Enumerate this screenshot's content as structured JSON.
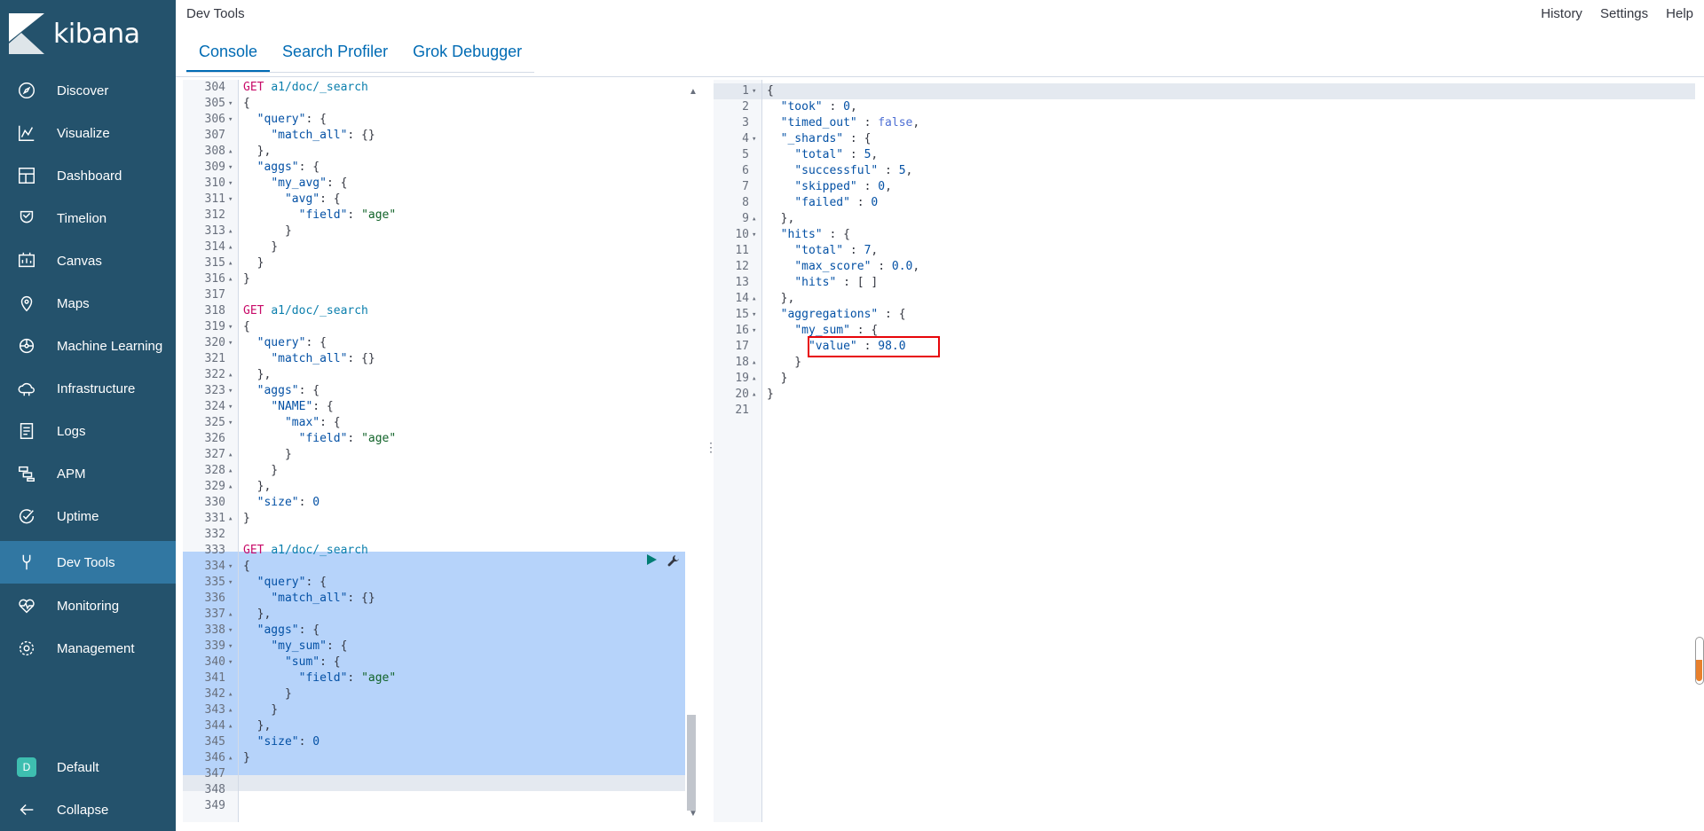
{
  "app": {
    "name": "kibana"
  },
  "sidebar": {
    "items": [
      {
        "label": "Discover",
        "icon": "compass-icon"
      },
      {
        "label": "Visualize",
        "icon": "visualize-icon"
      },
      {
        "label": "Dashboard",
        "icon": "dashboard-icon"
      },
      {
        "label": "Timelion",
        "icon": "timelion-icon"
      },
      {
        "label": "Canvas",
        "icon": "canvas-icon"
      },
      {
        "label": "Maps",
        "icon": "maps-icon"
      },
      {
        "label": "Machine Learning",
        "icon": "machine-learning-icon"
      },
      {
        "label": "Infrastructure",
        "icon": "infrastructure-icon"
      },
      {
        "label": "Logs",
        "icon": "logs-icon"
      },
      {
        "label": "APM",
        "icon": "apm-icon"
      },
      {
        "label": "Uptime",
        "icon": "uptime-icon"
      },
      {
        "label": "Dev Tools",
        "icon": "devtools-icon",
        "active": true
      },
      {
        "label": "Monitoring",
        "icon": "monitoring-icon"
      },
      {
        "label": "Management",
        "icon": "gear-icon"
      }
    ],
    "space": {
      "badge": "D",
      "label": "Default"
    },
    "collapse": {
      "label": "Collapse"
    }
  },
  "header": {
    "breadcrumb": "Dev Tools",
    "links": [
      "History",
      "Settings",
      "Help"
    ],
    "tabs": [
      {
        "label": "Console",
        "active": true
      },
      {
        "label": "Search Profiler"
      },
      {
        "label": "Grok Debugger"
      }
    ]
  },
  "colors": {
    "sidebar": "#24526c",
    "active": "#3177a2",
    "accent": "#006bb4",
    "highlight": "#e7050a",
    "selection": "#b6d3fa"
  },
  "editor": {
    "lines": [
      {
        "n": "304",
        "f": "",
        "code": "GET a1/doc/_search"
      },
      {
        "n": "305",
        "f": "▾",
        "code": "{"
      },
      {
        "n": "306",
        "f": "▾",
        "code": "  \"query\": {"
      },
      {
        "n": "307",
        "f": "",
        "code": "    \"match_all\": {}"
      },
      {
        "n": "308",
        "f": "▴",
        "code": "  },"
      },
      {
        "n": "309",
        "f": "▾",
        "code": "  \"aggs\": {"
      },
      {
        "n": "310",
        "f": "▾",
        "code": "    \"my_avg\": {"
      },
      {
        "n": "311",
        "f": "▾",
        "code": "      \"avg\": {"
      },
      {
        "n": "312",
        "f": "",
        "code": "        \"field\": \"age\""
      },
      {
        "n": "313",
        "f": "▴",
        "code": "      }"
      },
      {
        "n": "314",
        "f": "▴",
        "code": "    }"
      },
      {
        "n": "315",
        "f": "▴",
        "code": "  }"
      },
      {
        "n": "316",
        "f": "▴",
        "code": "}"
      },
      {
        "n": "317",
        "f": "",
        "code": ""
      },
      {
        "n": "318",
        "f": "",
        "code": "GET a1/doc/_search"
      },
      {
        "n": "319",
        "f": "▾",
        "code": "{"
      },
      {
        "n": "320",
        "f": "▾",
        "code": "  \"query\": {"
      },
      {
        "n": "321",
        "f": "",
        "code": "    \"match_all\": {}"
      },
      {
        "n": "322",
        "f": "▴",
        "code": "  },"
      },
      {
        "n": "323",
        "f": "▾",
        "code": "  \"aggs\": {"
      },
      {
        "n": "324",
        "f": "▾",
        "code": "    \"NAME\": {"
      },
      {
        "n": "325",
        "f": "▾",
        "code": "      \"max\": {"
      },
      {
        "n": "326",
        "f": "",
        "code": "        \"field\": \"age\""
      },
      {
        "n": "327",
        "f": "▴",
        "code": "      }"
      },
      {
        "n": "328",
        "f": "▴",
        "code": "    }"
      },
      {
        "n": "329",
        "f": "▴",
        "code": "  },"
      },
      {
        "n": "330",
        "f": "",
        "code": "  \"size\": 0"
      },
      {
        "n": "331",
        "f": "▴",
        "code": "}"
      },
      {
        "n": "332",
        "f": "",
        "code": ""
      },
      {
        "n": "333",
        "f": "",
        "code": "GET a1/doc/_search"
      },
      {
        "n": "334",
        "f": "▾",
        "code": "{"
      },
      {
        "n": "335",
        "f": "▾",
        "code": "  \"query\": {"
      },
      {
        "n": "336",
        "f": "",
        "code": "    \"match_all\": {}"
      },
      {
        "n": "337",
        "f": "▴",
        "code": "  },"
      },
      {
        "n": "338",
        "f": "▾",
        "code": "  \"aggs\": {"
      },
      {
        "n": "339",
        "f": "▾",
        "code": "    \"my_sum\": {"
      },
      {
        "n": "340",
        "f": "▾",
        "code": "      \"sum\": {"
      },
      {
        "n": "341",
        "f": "",
        "code": "        \"field\": \"age\""
      },
      {
        "n": "342",
        "f": "▴",
        "code": "      }"
      },
      {
        "n": "343",
        "f": "▴",
        "code": "    }"
      },
      {
        "n": "344",
        "f": "▴",
        "code": "  },"
      },
      {
        "n": "345",
        "f": "",
        "code": "  \"size\": 0"
      },
      {
        "n": "346",
        "f": "▴",
        "code": "}"
      },
      {
        "n": "347",
        "f": "",
        "code": ""
      },
      {
        "n": "348",
        "f": "",
        "code": ""
      },
      {
        "n": "349",
        "f": "",
        "code": ""
      }
    ]
  },
  "output": {
    "lines": [
      {
        "n": "1",
        "f": "▾",
        "code": "{"
      },
      {
        "n": "2",
        "f": "",
        "code": "  \"took\" : 0,"
      },
      {
        "n": "3",
        "f": "",
        "code": "  \"timed_out\" : false,"
      },
      {
        "n": "4",
        "f": "▾",
        "code": "  \"_shards\" : {"
      },
      {
        "n": "5",
        "f": "",
        "code": "    \"total\" : 5,"
      },
      {
        "n": "6",
        "f": "",
        "code": "    \"successful\" : 5,"
      },
      {
        "n": "7",
        "f": "",
        "code": "    \"skipped\" : 0,"
      },
      {
        "n": "8",
        "f": "",
        "code": "    \"failed\" : 0"
      },
      {
        "n": "9",
        "f": "▴",
        "code": "  },"
      },
      {
        "n": "10",
        "f": "▾",
        "code": "  \"hits\" : {"
      },
      {
        "n": "11",
        "f": "",
        "code": "    \"total\" : 7,"
      },
      {
        "n": "12",
        "f": "",
        "code": "    \"max_score\" : 0.0,"
      },
      {
        "n": "13",
        "f": "",
        "code": "    \"hits\" : [ ]"
      },
      {
        "n": "14",
        "f": "▴",
        "code": "  },"
      },
      {
        "n": "15",
        "f": "▾",
        "code": "  \"aggregations\" : {"
      },
      {
        "n": "16",
        "f": "▾",
        "code": "    \"my_sum\" : {"
      },
      {
        "n": "17",
        "f": "",
        "code": "      \"value\" : 98.0"
      },
      {
        "n": "18",
        "f": "▴",
        "code": "    }"
      },
      {
        "n": "19",
        "f": "▴",
        "code": "  }"
      },
      {
        "n": "20",
        "f": "▴",
        "code": "}"
      },
      {
        "n": "21",
        "f": "",
        "code": ""
      }
    ]
  }
}
